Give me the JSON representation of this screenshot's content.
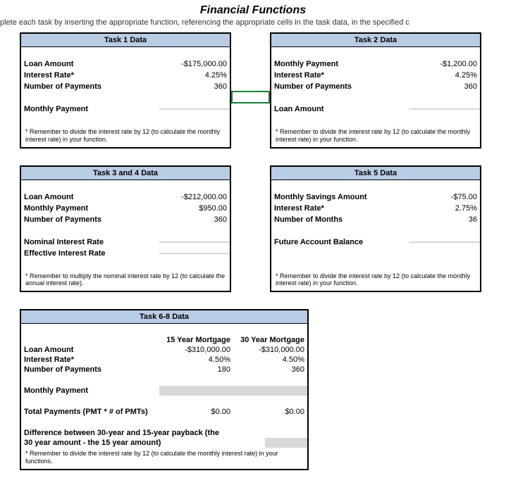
{
  "title": "Financial Functions",
  "instruction": "plete each task by inserting the appropriate function, referencing the appropriate cells in the task data, in the specified c",
  "task1": {
    "header": "Task 1 Data",
    "loan_amount_label": "Loan Amount",
    "loan_amount_value": "-$175,000.00",
    "interest_label": "Interest Rate*",
    "interest_value": "4.25%",
    "num_pay_label": "Number of Payments",
    "num_pay_value": "360",
    "result_label": "Monthly Payment",
    "footnote": "* Remember to divide the interest rate by 12 (to calculate the monthly interest rate) in your function."
  },
  "task2": {
    "header": "Task 2 Data",
    "monthly_pay_label": "Monthly Payment",
    "monthly_pay_value": "-$1,200.00",
    "interest_label": "Interest Rate*",
    "interest_value": "4.25%",
    "num_pay_label": "Number of Payments",
    "num_pay_value": "360",
    "result_label": "Loan Amount",
    "footnote": "* Remember to divide the interest rate by 12 (to calculate the monthly interest rate) in your function."
  },
  "task34": {
    "header": "Task 3 and 4 Data",
    "loan_amount_label": "Loan Amount",
    "loan_amount_value": "-$212,000.00",
    "monthly_pay_label": "Monthly Payment",
    "monthly_pay_value": "$950.00",
    "num_pay_label": "Number of Payments",
    "num_pay_value": "360",
    "result1_label": "Nominal Interest Rate",
    "result2_label": "Effective Interest Rate",
    "footnote": "* Remember to multiply the nominal interest rate by 12 (to calculate the annual interest rate)."
  },
  "task5": {
    "header": "Task 5 Data",
    "savings_label": "Monthly Savings Amount",
    "savings_value": "-$75.00",
    "interest_label": "Interest Rate*",
    "interest_value": "2.75%",
    "months_label": "Number of Months",
    "months_value": "36",
    "result_label": "Future Account Balance",
    "footnote": "* Remember to divide the interest rate by 12 (to calculate the monthly interest rate) in your function."
  },
  "task68": {
    "header": "Task 6-8 Data",
    "col1_head": "15 Year Mortgage",
    "col2_head": "30 Year Mortgage",
    "loan_amount_label": "Loan Amount",
    "loan_amount_c1": "-$310,000.00",
    "loan_amount_c2": "-$310,000.00",
    "interest_label": "Interest Rate*",
    "interest_c1": "4.50%",
    "interest_c2": "4.50%",
    "num_pay_label": "Number of Payments",
    "num_pay_c1": "180",
    "num_pay_c2": "360",
    "monthly_pay_label": "Monthly Payment",
    "total_pay_label": "Total Payments (PMT * # of PMTs)",
    "total_pay_c1": "$0.00",
    "total_pay_c2": "$0.00",
    "diff_label_1": "Difference between 30-year and 15-year payback (the",
    "diff_label_2": "30 year amount  - the 15 year amount)",
    "footnote": "* Remember to divide the interest rate by 12 (to calculate the monthly interest rate) in your functions."
  }
}
